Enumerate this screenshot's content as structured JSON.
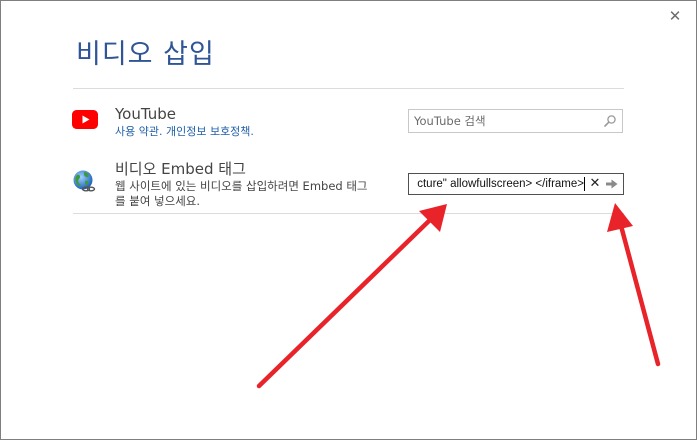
{
  "dialog": {
    "title": "비디오 삽입",
    "close_glyph": "✕"
  },
  "youtube": {
    "icon": "youtube-logo-icon",
    "name": "YouTube",
    "terms_link": "사용 약관. 개인정보 보호정책.",
    "search_placeholder": "YouTube 검색",
    "search_icon": "magnifier-icon"
  },
  "embed": {
    "icon": "globe-link-icon",
    "name": "비디오 Embed 태그",
    "description": "웹 사이트에 있는 비디오를 삽입하려면 Embed 태그를 붙여 넣으세요.",
    "input_value": "cture\" allowfullscreen> </iframe>",
    "clear_glyph": "✕",
    "go_icon": "arrow-right-icon"
  },
  "annotation": {
    "arrow_color": "#e8232a"
  },
  "colors": {
    "title": "#2f5597",
    "link": "#1f5fa8",
    "youtube_red": "#ff0000"
  }
}
